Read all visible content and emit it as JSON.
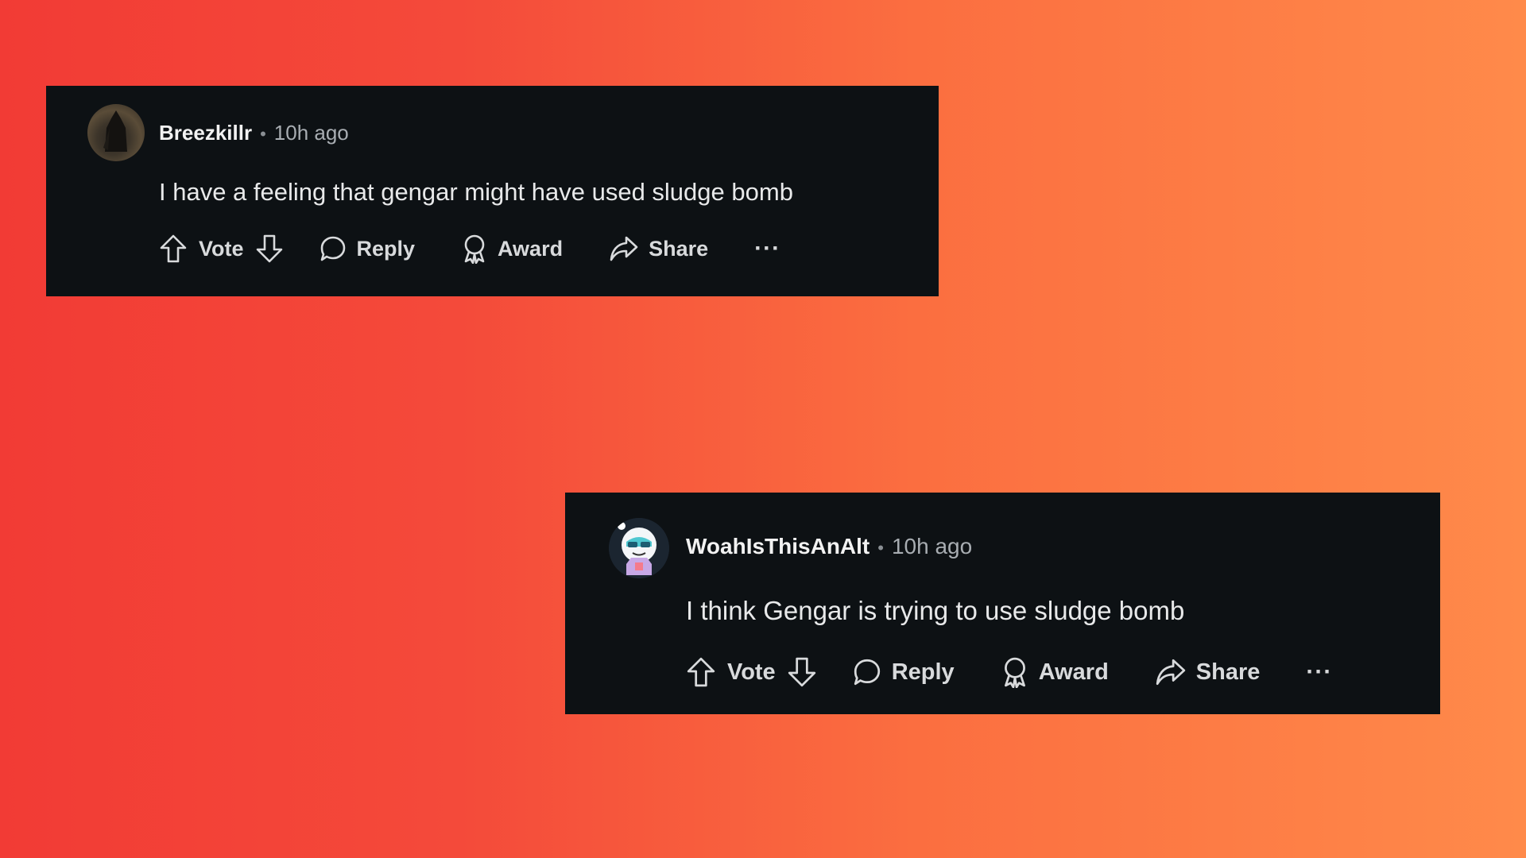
{
  "comments": [
    {
      "username": "Breezkillr",
      "separator": "•",
      "timestamp": "10h ago",
      "text": "I have a feeling that gengar might have used sludge bomb",
      "actions": {
        "vote": "Vote",
        "reply": "Reply",
        "award": "Award",
        "share": "Share",
        "more": "···"
      }
    },
    {
      "username": "WoahIsThisAnAlt",
      "separator": "•",
      "timestamp": "10h ago",
      "text": "I think Gengar is trying to use sludge bomb",
      "actions": {
        "vote": "Vote",
        "reply": "Reply",
        "award": "Award",
        "share": "Share",
        "more": "···"
      }
    }
  ],
  "colors": {
    "card_bg": "#0d1114",
    "background_start": "#f23b35",
    "background_end": "#ff8a4a",
    "text_primary": "#f2f2f2",
    "text_secondary": "#a8adb2"
  },
  "icons": [
    "upvote-icon",
    "downvote-icon",
    "reply-icon",
    "award-icon",
    "share-icon",
    "more-icon"
  ]
}
